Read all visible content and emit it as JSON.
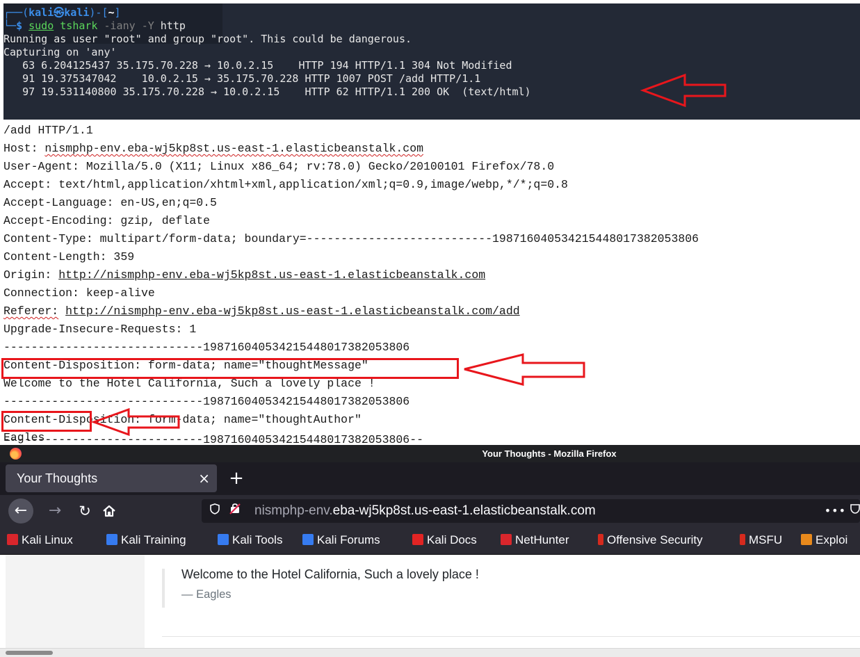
{
  "terminal": {
    "prompt_user": "kali",
    "prompt_host": "kali",
    "prompt_dir": "~",
    "command_sudo": "sudo",
    "command_rest": " tshark ",
    "command_flag_any": "-iany",
    "command_flag_y": "-Y",
    "command_filter": "http",
    "lines": [
      "Running as user \"root\" and group \"root\". This could be dangerous.",
      "Capturing on 'any'",
      "   63 6.204125437 35.175.70.228 → 10.0.2.15    HTTP 194 HTTP/1.1 304 Not Modified",
      "   91 19.375347042    10.0.2.15 → 35.175.70.228 HTTP 1007 POST /add HTTP/1.1",
      "   97 19.531140800 35.175.70.228 → 10.0.2.15    HTTP 62 HTTP/1.1 200 OK  (text/html)"
    ]
  },
  "payload": {
    "request_line": "/add HTTP/1.1",
    "host_label": "Host:",
    "host_value": "nismphp-env.eba-wj5kp8st.us-east-1.elasticbeanstalk.com",
    "ua_label": "User-Agent:",
    "ua_value": "Mozilla/5.0 (X11; Linux x86_64; rv:78.0) Gecko/20100101 Firefox/78.0",
    "accept_label": "Accept:",
    "accept_value": "text/html,application/xhtml+xml,application/xml;q=0.9,image/webp,*/*;q=0.8",
    "accept_lang": "Accept-Language: en-US,en;q=0.5",
    "accept_enc": "Accept-Encoding: gzip, deflate",
    "content_type": "Content-Type: multipart/form-data; boundary=---------------------------198716040534215448017382053806",
    "content_length": "Content-Length: 359",
    "origin_label": "Origin:",
    "origin_value": "http://nismphp-env.eba-wj5kp8st.us-east-1.elasticbeanstalk.com",
    "connection": "Connection: keep-alive",
    "referer_label": "Referer:",
    "referer_value": "http://nismphp-env.eba-wj5kp8st.us-east-1.elasticbeanstalk.com/add",
    "upgrade": "Upgrade-Insecure-Requests: 1",
    "boundary1": "-----------------------------198716040534215448017382053806",
    "disposition_message": "Content-Disposition: form-data; name=\"thoughtMessage\"",
    "message_value": "Welcome to the Hotel California, Such a lovely place !",
    "boundary2": "-----------------------------198716040534215448017382053806",
    "disposition_author": "Content-Disposition: form-data; name=\"thoughtAuthor\"",
    "author_value": "Eagles",
    "boundary_end": "-----------------------------198716040534215448017382053806--"
  },
  "firefox": {
    "window_title": "Your Thoughts - Mozilla Firefox",
    "tab_label": "Your Thoughts",
    "tab_close": "×",
    "newtab": "+",
    "url_dim_prefix": "nismphp-env.",
    "url_main": "eba-wj5kp8st.us-east-1.elasticbeanstalk.com",
    "url_more": "•••",
    "bookmarks": [
      {
        "label": "Kali Linux",
        "color": "#d9262c"
      },
      {
        "label": "Kali Training",
        "color": "#367bf0"
      },
      {
        "label": "Kali Tools",
        "color": "#367bf0"
      },
      {
        "label": "Kali Forums",
        "color": "#367bf0"
      },
      {
        "label": "Kali Docs",
        "color": "#e22424"
      },
      {
        "label": "NetHunter",
        "color": "#d9262c"
      },
      {
        "label": "Offensive Security",
        "color": "#d62a1e"
      },
      {
        "label": "MSFU",
        "color": "#d62a1e"
      },
      {
        "label": "Exploi",
        "color": "#e8891c"
      }
    ],
    "quote_text": "Welcome to the Hotel California, Such a lovely place !",
    "quote_author": "— Eagles"
  },
  "colors": {
    "annotation_red": "#e8161c",
    "terminal_bg": "#232936",
    "firefox_chrome": "#2b2a33"
  }
}
